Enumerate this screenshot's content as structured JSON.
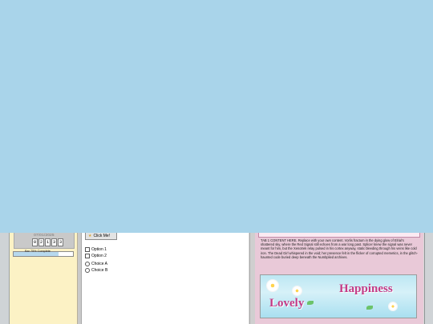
{
  "clock": {
    "date": "07/01/2025",
    "digits": [
      "0",
      "2",
      "1",
      "3",
      "3"
    ]
  },
  "progress": {
    "fraction": 0.75,
    "label": "Bar 75% Complete"
  },
  "center": {
    "click_button": "Click Me!",
    "checkboxes": [
      "Option 1",
      "Option 2"
    ],
    "radios": [
      "Choice A",
      "Choice B"
    ]
  },
  "tab": {
    "content": "TAB 1 CONTENT HERE. Replace with your own content.\nVorlis fractum in the dying glow of Elrial’s shattered sky, where the Red Signal still echoes from a war long past. Splicer knew the signal was never meant for him, but the Xenotrek relay pulsed in his cortex anyway, static bleeding through his veins like cold iron. The Dead Girl whispered in the void; her presence felt in the flicker of corrupted memetics, in the glitch-haunted code buried deep beneath the Numbplied archives."
  },
  "banner": {
    "word_left": "Lovely",
    "word_right": "Happiness"
  },
  "colors": {
    "desktop": "#a9d4ea",
    "sidebar": "#fcf2c5",
    "panel_pink": "#e9c9d8",
    "banner_text": "#c43b86"
  }
}
